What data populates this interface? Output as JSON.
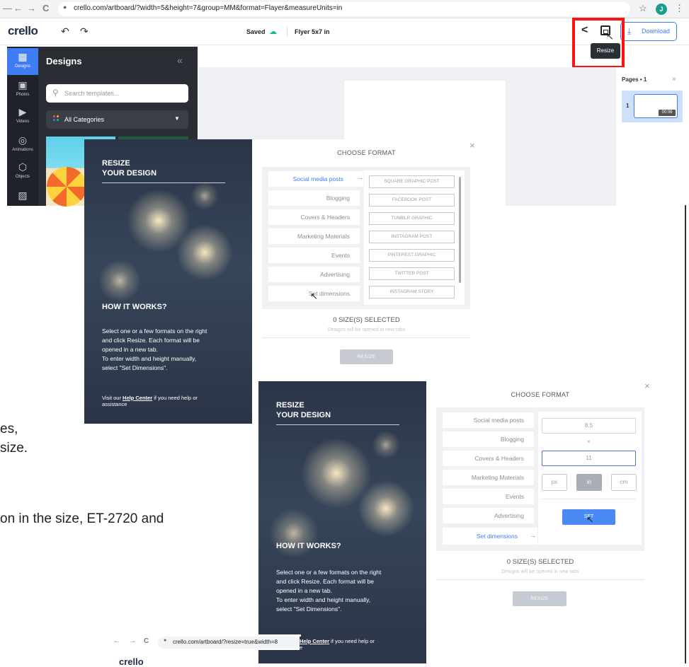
{
  "browser": {
    "url": "crello.com/artboard/?width=5&height=7&group=MM&format=Flayer&measureUnits=in",
    "profile_initial": "J",
    "back": "←",
    "forward": "→",
    "reload": "C",
    "lock": "🔒",
    "star": "☆",
    "menu": "⋮"
  },
  "header": {
    "logo": "crello",
    "undo": "↶",
    "redo": "↷",
    "saved": "Saved",
    "doc_title": "Flyer 5x7 in",
    "download": "Download",
    "tooltip": "Resize",
    "highlight_color": "#ff1111"
  },
  "sidebar": {
    "items": [
      {
        "label": "Designs",
        "icon": "designs-icon",
        "glyph": "▦"
      },
      {
        "label": "Photos",
        "icon": "photos-icon",
        "glyph": "▣"
      },
      {
        "label": "Videos",
        "icon": "videos-icon",
        "glyph": "▶"
      },
      {
        "label": "Animations",
        "icon": "animations-icon",
        "glyph": "◎"
      },
      {
        "label": "Objects",
        "icon": "objects-icon",
        "glyph": "⬡"
      },
      {
        "label": "",
        "icon": "background-icon",
        "glyph": "▨"
      }
    ]
  },
  "designs_panel": {
    "title": "Designs",
    "collapse": "«",
    "search_placeholder": "Search templates...",
    "category": "All Categories"
  },
  "pages_panel": {
    "title": "Pages • 1",
    "arrow": "»",
    "page_number": "1",
    "duration": "00:06"
  },
  "document": {
    "line1": "es,",
    "line2": "size.",
    "line3": "on in the size, ET-2720 and"
  },
  "dialog1": {
    "title_line1": "RESIZE",
    "title_line2": "YOUR DESIGN",
    "how_title": "HOW IT WORKS?",
    "how_lines": [
      "Select one or a few formats on the right",
      "and click Resize. Each format will be",
      "opened in a new tab.",
      "To enter width and height manually,",
      "select \"Set Dimensions\"."
    ],
    "visit_prefix": "Visit our ",
    "help_link": "Help Center",
    "visit_suffix": " if you need help or",
    "visit_line2": "assistance",
    "choose": "CHOOSE FORMAT",
    "categories": [
      "Social media posts",
      "Blogging",
      "Covers & Headers",
      "Marketing Materials",
      "Events",
      "Advertising",
      "Set dimensions"
    ],
    "selected_arrow": "→",
    "options": [
      "SQUARE GRAPHIC POST",
      "FACEBOOK POST",
      "TUMBLR GRAPHIC",
      "INSTAGRAM POST",
      "PINTEREST GRAPHIC",
      "TWITTER POST",
      "INSTAGRAM STORY"
    ],
    "sizes_selected": "0 SIZE(S) SELECTED",
    "opened_note": "Designs will be opened in new tabs",
    "resize_button": "RESIZE",
    "close": "×"
  },
  "dialog2": {
    "title_line1": "RESIZE",
    "title_line2": "YOUR DESIGN",
    "how_title": "HOW IT WORKS?",
    "how_lines": [
      "Select one or a few formats on the right",
      "and click Resize. Each format will be",
      "opened in a new tab.",
      "To enter width and height manually,",
      "select \"Set Dimensions\"."
    ],
    "choose": "CHOOSE FORMAT",
    "categories": [
      "Social media posts",
      "Blogging",
      "Covers & Headers",
      "Marketing Materials",
      "Events",
      "Advertising",
      "Set dimensions"
    ],
    "selected_arrow": "→",
    "width_value": "8.5",
    "times": "×",
    "height_value": "11",
    "units": [
      "px",
      "in",
      "cm"
    ],
    "selected_unit": "in",
    "set_button": "SET",
    "sizes_selected": "0 SIZE(S) SELECTED",
    "opened_note": "Designs will be opened in new tabs",
    "resize_button": "RESIZE",
    "close": "×"
  },
  "bottom_browser": {
    "url": "crello.com/artboard/?resize=true&width=8",
    "back": "←",
    "forward": "→",
    "reload": "C",
    "help_link": "Help Center",
    "help_suffix": " if you need help or",
    "help_line2": "e",
    "logo": "crello"
  }
}
